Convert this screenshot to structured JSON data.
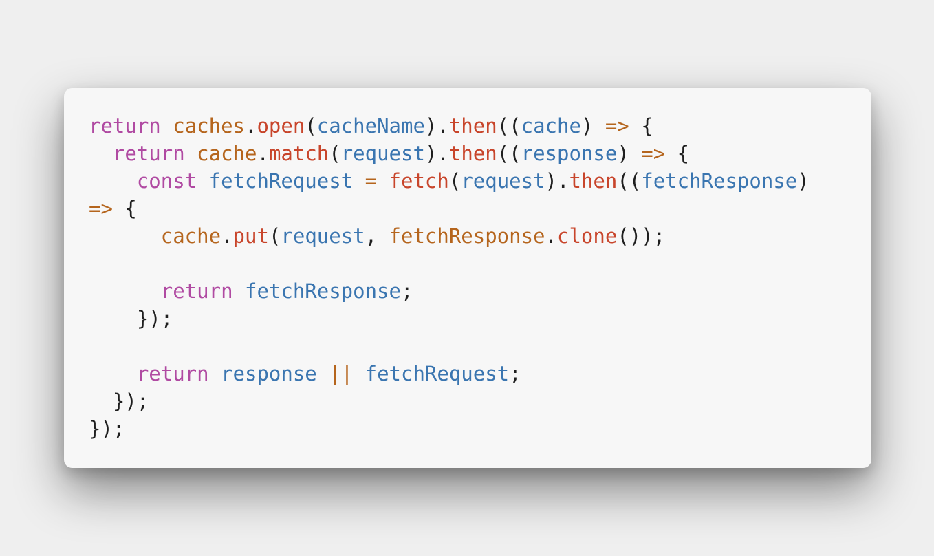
{
  "colors": {
    "background": "#efefef",
    "card": "#f7f7f7",
    "keyword": "#b04aa2",
    "object": "#b5651d",
    "function": "#c8452b",
    "variable": "#3a75b0",
    "operator": "#b5651d",
    "punctuation": "#1f1f1f"
  },
  "code": {
    "lines": [
      [
        {
          "t": "return",
          "k": "kw"
        },
        {
          "t": " ",
          "k": "pn"
        },
        {
          "t": "caches",
          "k": "obj"
        },
        {
          "t": ".",
          "k": "pn"
        },
        {
          "t": "open",
          "k": "fn"
        },
        {
          "t": "(",
          "k": "pn"
        },
        {
          "t": "cacheName",
          "k": "var"
        },
        {
          "t": ").",
          "k": "pn"
        },
        {
          "t": "then",
          "k": "fn"
        },
        {
          "t": "((",
          "k": "pn"
        },
        {
          "t": "cache",
          "k": "var"
        },
        {
          "t": ") ",
          "k": "pn"
        },
        {
          "t": "=>",
          "k": "op"
        },
        {
          "t": " {",
          "k": "pn"
        }
      ],
      [
        {
          "t": "  ",
          "k": "pn"
        },
        {
          "t": "return",
          "k": "kw"
        },
        {
          "t": " ",
          "k": "pn"
        },
        {
          "t": "cache",
          "k": "obj"
        },
        {
          "t": ".",
          "k": "pn"
        },
        {
          "t": "match",
          "k": "fn"
        },
        {
          "t": "(",
          "k": "pn"
        },
        {
          "t": "request",
          "k": "var"
        },
        {
          "t": ").",
          "k": "pn"
        },
        {
          "t": "then",
          "k": "fn"
        },
        {
          "t": "((",
          "k": "pn"
        },
        {
          "t": "response",
          "k": "var"
        },
        {
          "t": ") ",
          "k": "pn"
        },
        {
          "t": "=>",
          "k": "op"
        },
        {
          "t": " {",
          "k": "pn"
        }
      ],
      [
        {
          "t": "    ",
          "k": "pn"
        },
        {
          "t": "const",
          "k": "kw"
        },
        {
          "t": " ",
          "k": "pn"
        },
        {
          "t": "fetchRequest",
          "k": "var"
        },
        {
          "t": " ",
          "k": "pn"
        },
        {
          "t": "=",
          "k": "op"
        },
        {
          "t": " ",
          "k": "pn"
        },
        {
          "t": "fetch",
          "k": "fn"
        },
        {
          "t": "(",
          "k": "pn"
        },
        {
          "t": "request",
          "k": "var"
        },
        {
          "t": ").",
          "k": "pn"
        },
        {
          "t": "then",
          "k": "fn"
        },
        {
          "t": "((",
          "k": "pn"
        },
        {
          "t": "fetchResponse",
          "k": "var"
        },
        {
          "t": ")",
          "k": "pn"
        }
      ],
      [
        {
          "t": "=>",
          "k": "op"
        },
        {
          "t": " {",
          "k": "pn"
        }
      ],
      [
        {
          "t": "      ",
          "k": "pn"
        },
        {
          "t": "cache",
          "k": "obj"
        },
        {
          "t": ".",
          "k": "pn"
        },
        {
          "t": "put",
          "k": "fn"
        },
        {
          "t": "(",
          "k": "pn"
        },
        {
          "t": "request",
          "k": "var"
        },
        {
          "t": ", ",
          "k": "pn"
        },
        {
          "t": "fetchResponse",
          "k": "obj"
        },
        {
          "t": ".",
          "k": "pn"
        },
        {
          "t": "clone",
          "k": "fn"
        },
        {
          "t": "());",
          "k": "pn"
        }
      ],
      [],
      [
        {
          "t": "      ",
          "k": "pn"
        },
        {
          "t": "return",
          "k": "kw"
        },
        {
          "t": " ",
          "k": "pn"
        },
        {
          "t": "fetchResponse",
          "k": "var"
        },
        {
          "t": ";",
          "k": "pn"
        }
      ],
      [
        {
          "t": "    });",
          "k": "pn"
        }
      ],
      [],
      [
        {
          "t": "    ",
          "k": "pn"
        },
        {
          "t": "return",
          "k": "kw"
        },
        {
          "t": " ",
          "k": "pn"
        },
        {
          "t": "response",
          "k": "var"
        },
        {
          "t": " ",
          "k": "pn"
        },
        {
          "t": "||",
          "k": "op"
        },
        {
          "t": " ",
          "k": "pn"
        },
        {
          "t": "fetchRequest",
          "k": "var"
        },
        {
          "t": ";",
          "k": "pn"
        }
      ],
      [
        {
          "t": "  });",
          "k": "pn"
        }
      ],
      [
        {
          "t": "});",
          "k": "pn"
        }
      ]
    ]
  }
}
